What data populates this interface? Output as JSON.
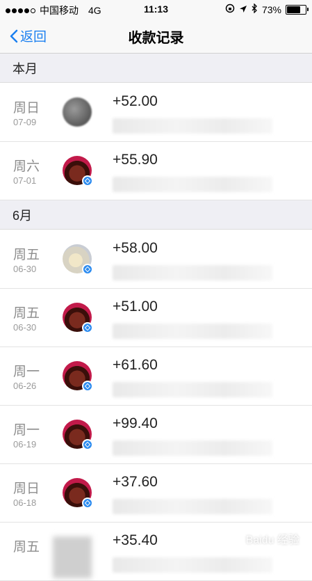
{
  "status": {
    "carrier": "中国移动",
    "network": "4G",
    "time": "11:13",
    "battery": "73%",
    "battery_level": 0.73
  },
  "nav": {
    "back_label": "返回",
    "title": "收款记录"
  },
  "sections": [
    {
      "label": "本月",
      "rows": [
        {
          "day": "周日",
          "date": "07-09",
          "amount": "+52.00",
          "avatar": "gray"
        },
        {
          "day": "周六",
          "date": "07-01",
          "amount": "+55.90",
          "avatar": "red"
        }
      ]
    },
    {
      "label": "6月",
      "rows": [
        {
          "day": "周五",
          "date": "06-30",
          "amount": "+58.00",
          "avatar": "light"
        },
        {
          "day": "周五",
          "date": "06-30",
          "amount": "+51.00",
          "avatar": "red"
        },
        {
          "day": "周一",
          "date": "06-26",
          "amount": "+61.60",
          "avatar": "red"
        },
        {
          "day": "周一",
          "date": "06-19",
          "amount": "+99.40",
          "avatar": "red"
        },
        {
          "day": "周日",
          "date": "06-18",
          "amount": "+37.60",
          "avatar": "red"
        },
        {
          "day": "周五",
          "date": "",
          "amount": "+35.40",
          "avatar": "square"
        }
      ]
    }
  ],
  "colors": {
    "accent": "#1a7ff0",
    "section_bg": "#efeff4",
    "badge": "#2d8cf0"
  }
}
